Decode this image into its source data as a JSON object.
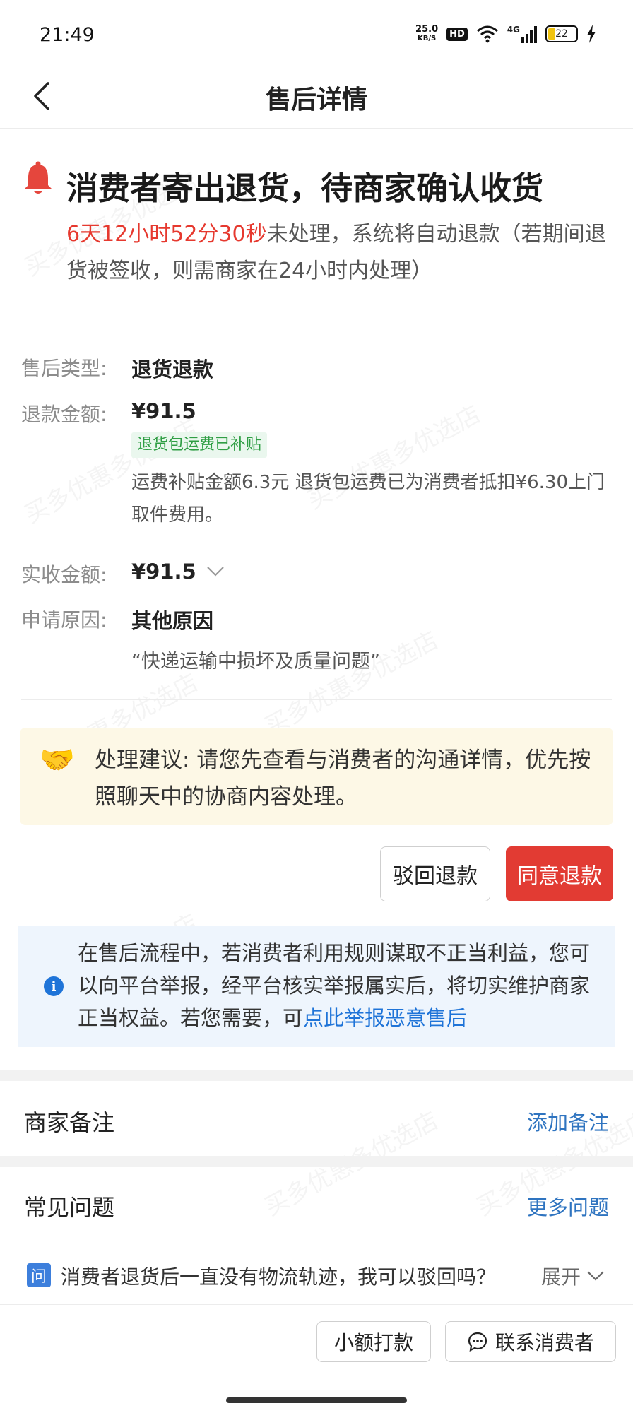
{
  "status_bar": {
    "time": "21:49",
    "speed_value": "25.0",
    "speed_unit": "KB/S",
    "hd_label": "HD",
    "network_label": "4G",
    "battery": "22"
  },
  "header": {
    "title": "售后详情"
  },
  "watermark": "买多优惠多优选店",
  "status": {
    "headline": "消费者寄出退货，待商家确认收货",
    "countdown": "6天12小时52分30秒",
    "desc_rest": "未处理，系统将自动退款（若期间退货被签收，则需商家在24小时内处理）"
  },
  "details": {
    "type_label": "售后类型:",
    "type_value": "退货退款",
    "refund_label": "退款金额:",
    "refund_value": "¥91.5",
    "refund_tag": "退货包运费已补贴",
    "refund_note": "运费补贴金额6.3元 退货包运费已为消费者抵扣¥6.30上门取件费用。",
    "received_label": "实收金额:",
    "received_value": "¥91.5",
    "reason_label": "申请原因:",
    "reason_value": "其他原因",
    "reason_quote": "“快递运输中损坏及质量问题”"
  },
  "suggestion": {
    "text": "处理建议: 请您先查看与消费者的沟通详情，优先按照聊天中的协商内容处理。"
  },
  "actions": {
    "reject_label": "驳回退款",
    "agree_label": "同意退款"
  },
  "info": {
    "text": "在售后流程中，若消费者利用规则谋取不正当利益，您可以向平台举报，经平台核实举报属实后，将切实维护商家正当权益。若您需要，可",
    "link": "点此举报恶意售后"
  },
  "merchant_note": {
    "title": "商家备注",
    "action": "添加备注"
  },
  "faq": {
    "title": "常见问题",
    "more": "更多问题",
    "icon_label": "问",
    "question": "消费者退货后一直没有物流轨迹，我可以驳回吗？",
    "expand": "展开"
  },
  "bottom": {
    "small_payment": "小额打款",
    "contact": "联系消费者"
  },
  "colors": {
    "accent_red": "#e23b33",
    "link_blue": "#2f74c0",
    "countdown_red": "#e6392f"
  }
}
